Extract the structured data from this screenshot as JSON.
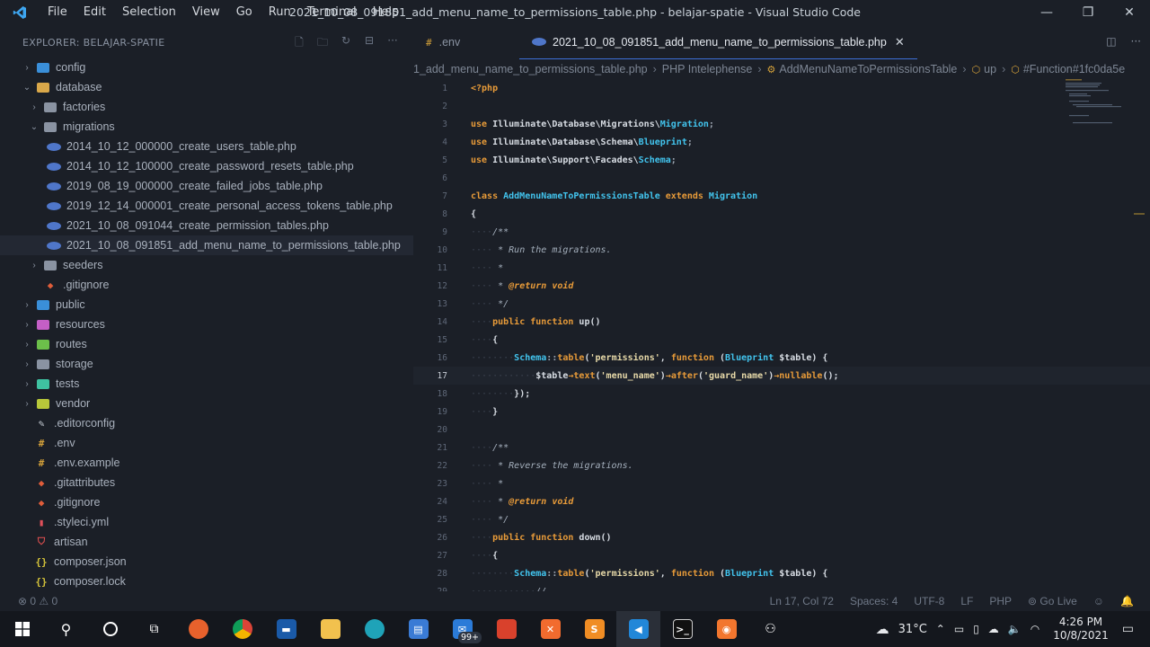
{
  "titlebar": {
    "menus": [
      "File",
      "Edit",
      "Selection",
      "View",
      "Go",
      "Run",
      "Terminal",
      "Help"
    ],
    "title": "2021_10_08_091851_add_menu_name_to_permissions_table.php - belajar-spatie - Visual Studio Code"
  },
  "explorer": {
    "header": "EXPLORER: BELAJAR-SPATIE",
    "items": [
      {
        "label": "config",
        "type": "folder",
        "depth": 0,
        "chev": "closed",
        "color": "#3a8fd9"
      },
      {
        "label": "database",
        "type": "folder",
        "depth": 0,
        "chev": "open",
        "color": "#d9a84a"
      },
      {
        "label": "factories",
        "type": "folder",
        "depth": 1,
        "chev": "closed",
        "color": "#8a93a2"
      },
      {
        "label": "migrations",
        "type": "folder",
        "depth": 1,
        "chev": "open",
        "color": "#8a93a2"
      },
      {
        "label": "2014_10_12_000000_create_users_table.php",
        "type": "php",
        "depth": 2
      },
      {
        "label": "2014_10_12_100000_create_password_resets_table.php",
        "type": "php",
        "depth": 2
      },
      {
        "label": "2019_08_19_000000_create_failed_jobs_table.php",
        "type": "php",
        "depth": 2
      },
      {
        "label": "2019_12_14_000001_create_personal_access_tokens_table.php",
        "type": "php",
        "depth": 2
      },
      {
        "label": "2021_10_08_091044_create_permission_tables.php",
        "type": "php",
        "depth": 2
      },
      {
        "label": "2021_10_08_091851_add_menu_name_to_permissions_table.php",
        "type": "php",
        "depth": 2,
        "selected": true
      },
      {
        "label": "seeders",
        "type": "folder",
        "depth": 1,
        "chev": "closed",
        "color": "#8a93a2"
      },
      {
        "label": ".gitignore",
        "type": "git",
        "depth": 1
      },
      {
        "label": "public",
        "type": "folder",
        "depth": 0,
        "chev": "closed",
        "color": "#3a8fd9"
      },
      {
        "label": "resources",
        "type": "folder",
        "depth": 0,
        "chev": "closed",
        "color": "#c45fc6"
      },
      {
        "label": "routes",
        "type": "folder",
        "depth": 0,
        "chev": "closed",
        "color": "#6cbf4a"
      },
      {
        "label": "storage",
        "type": "folder",
        "depth": 0,
        "chev": "closed",
        "color": "#8a93a2"
      },
      {
        "label": "tests",
        "type": "folder",
        "depth": 0,
        "chev": "closed",
        "color": "#3fc2a1"
      },
      {
        "label": "vendor",
        "type": "folder",
        "depth": 0,
        "chev": "closed",
        "color": "#b8c83a"
      },
      {
        "label": ".editorconfig",
        "type": "gear",
        "depth": 0
      },
      {
        "label": ".env",
        "type": "hash",
        "depth": 0
      },
      {
        "label": ".env.example",
        "type": "hash",
        "depth": 0
      },
      {
        "label": ".gitattributes",
        "type": "git",
        "depth": 0
      },
      {
        "label": ".gitignore",
        "type": "git",
        "depth": 0
      },
      {
        "label": ".styleci.yml",
        "type": "yml",
        "depth": 0
      },
      {
        "label": "artisan",
        "type": "laravel",
        "depth": 0
      },
      {
        "label": "composer.json",
        "type": "json",
        "depth": 0
      },
      {
        "label": "composer.lock",
        "type": "json",
        "depth": 0
      }
    ]
  },
  "tabs": [
    {
      "label": ".env",
      "active": false
    },
    {
      "label": "2021_10_08_091851_add_menu_name_to_permissions_table.php",
      "active": true,
      "close": "✕"
    }
  ],
  "breadcrumb": [
    "1_add_menu_name_to_permissions_table.php",
    "PHP Intelephense",
    "AddMenuNameToPermissionsTable",
    "up",
    "#Function#1fc0da5e"
  ],
  "code": {
    "current_line": 17,
    "lines": [
      [
        {
          "t": "<?php",
          "c": "kw"
        }
      ],
      [],
      [
        {
          "t": "use ",
          "c": "kw"
        },
        {
          "t": "Illuminate\\Database\\Migrations\\",
          "c": ""
        },
        {
          "t": "Migration",
          "c": "cls"
        },
        {
          "t": ";",
          "c": "punc"
        }
      ],
      [
        {
          "t": "use ",
          "c": "kw"
        },
        {
          "t": "Illuminate\\Database\\Schema\\",
          "c": ""
        },
        {
          "t": "Blueprint",
          "c": "cls"
        },
        {
          "t": ";",
          "c": "punc"
        }
      ],
      [
        {
          "t": "use ",
          "c": "kw"
        },
        {
          "t": "Illuminate\\Support\\Facades\\",
          "c": ""
        },
        {
          "t": "Schema",
          "c": "cls"
        },
        {
          "t": ";",
          "c": "punc"
        }
      ],
      [],
      [
        {
          "t": "class ",
          "c": "kw"
        },
        {
          "t": "AddMenuNameToPermissionsTable ",
          "c": "cls"
        },
        {
          "t": "extends ",
          "c": "kw"
        },
        {
          "t": "Migration",
          "c": "cls"
        }
      ],
      [
        {
          "t": "{",
          "c": ""
        }
      ],
      [
        {
          "t": "····",
          "c": "ws"
        },
        {
          "t": "/**",
          "c": "cm"
        }
      ],
      [
        {
          "t": "····",
          "c": "ws"
        },
        {
          "t": " * Run the migrations.",
          "c": "cm"
        }
      ],
      [
        {
          "t": "····",
          "c": "ws"
        },
        {
          "t": " *",
          "c": "cm"
        }
      ],
      [
        {
          "t": "····",
          "c": "ws"
        },
        {
          "t": " * ",
          "c": "cm"
        },
        {
          "t": "@return void",
          "c": "tag"
        }
      ],
      [
        {
          "t": "····",
          "c": "ws"
        },
        {
          "t": " */",
          "c": "cm"
        }
      ],
      [
        {
          "t": "····",
          "c": "ws"
        },
        {
          "t": "public function ",
          "c": "kw"
        },
        {
          "t": "up",
          "c": ""
        },
        {
          "t": "()",
          "c": ""
        }
      ],
      [
        {
          "t": "····",
          "c": "ws"
        },
        {
          "t": "{",
          "c": ""
        }
      ],
      [
        {
          "t": "········",
          "c": "ws"
        },
        {
          "t": "Schema",
          "c": "cls"
        },
        {
          "t": "::",
          "c": "punc"
        },
        {
          "t": "table",
          "c": "fn"
        },
        {
          "t": "(",
          "c": ""
        },
        {
          "t": "'permissions'",
          "c": "str"
        },
        {
          "t": ", ",
          "c": ""
        },
        {
          "t": "function ",
          "c": "kw"
        },
        {
          "t": "(",
          "c": ""
        },
        {
          "t": "Blueprint ",
          "c": "cls"
        },
        {
          "t": "$table) {",
          "c": ""
        }
      ],
      [
        {
          "t": "············",
          "c": "ws"
        },
        {
          "t": "$table",
          "c": ""
        },
        {
          "t": "→",
          "c": "kw"
        },
        {
          "t": "text",
          "c": "fn"
        },
        {
          "t": "(",
          "c": ""
        },
        {
          "t": "'menu_name'",
          "c": "str"
        },
        {
          "t": ")",
          "c": ""
        },
        {
          "t": "→",
          "c": "kw"
        },
        {
          "t": "after",
          "c": "fn"
        },
        {
          "t": "(",
          "c": ""
        },
        {
          "t": "'guard_name'",
          "c": "str"
        },
        {
          "t": ")",
          "c": ""
        },
        {
          "t": "→",
          "c": "kw"
        },
        {
          "t": "nullable",
          "c": "fn"
        },
        {
          "t": "();",
          "c": ""
        }
      ],
      [
        {
          "t": "········",
          "c": "ws"
        },
        {
          "t": "});",
          "c": ""
        }
      ],
      [
        {
          "t": "····",
          "c": "ws"
        },
        {
          "t": "}",
          "c": ""
        }
      ],
      [],
      [
        {
          "t": "····",
          "c": "ws"
        },
        {
          "t": "/**",
          "c": "cm"
        }
      ],
      [
        {
          "t": "····",
          "c": "ws"
        },
        {
          "t": " * Reverse the migrations.",
          "c": "cm"
        }
      ],
      [
        {
          "t": "····",
          "c": "ws"
        },
        {
          "t": " *",
          "c": "cm"
        }
      ],
      [
        {
          "t": "····",
          "c": "ws"
        },
        {
          "t": " * ",
          "c": "cm"
        },
        {
          "t": "@return void",
          "c": "tag"
        }
      ],
      [
        {
          "t": "····",
          "c": "ws"
        },
        {
          "t": " */",
          "c": "cm"
        }
      ],
      [
        {
          "t": "····",
          "c": "ws"
        },
        {
          "t": "public function ",
          "c": "kw"
        },
        {
          "t": "down",
          "c": ""
        },
        {
          "t": "()",
          "c": ""
        }
      ],
      [
        {
          "t": "····",
          "c": "ws"
        },
        {
          "t": "{",
          "c": ""
        }
      ],
      [
        {
          "t": "········",
          "c": "ws"
        },
        {
          "t": "Schema",
          "c": "cls"
        },
        {
          "t": "::",
          "c": "punc"
        },
        {
          "t": "table",
          "c": "fn"
        },
        {
          "t": "(",
          "c": ""
        },
        {
          "t": "'permissions'",
          "c": "str"
        },
        {
          "t": ", ",
          "c": ""
        },
        {
          "t": "function ",
          "c": "kw"
        },
        {
          "t": "(",
          "c": ""
        },
        {
          "t": "Blueprint ",
          "c": "cls"
        },
        {
          "t": "$table) {",
          "c": ""
        }
      ],
      [
        {
          "t": "············",
          "c": "ws"
        },
        {
          "t": "//",
          "c": "cm"
        }
      ]
    ]
  },
  "status": {
    "problems": "⊗ 0 ⚠ 0",
    "position": "Ln 17, Col 72",
    "spaces": "Spaces: 4",
    "encoding": "UTF-8",
    "eol": "LF",
    "language": "PHP",
    "golive": "Go Live"
  },
  "taskbar": {
    "badge": "99+",
    "temperature": "31°C",
    "time": "4:26 PM",
    "date": "10/8/2021"
  }
}
